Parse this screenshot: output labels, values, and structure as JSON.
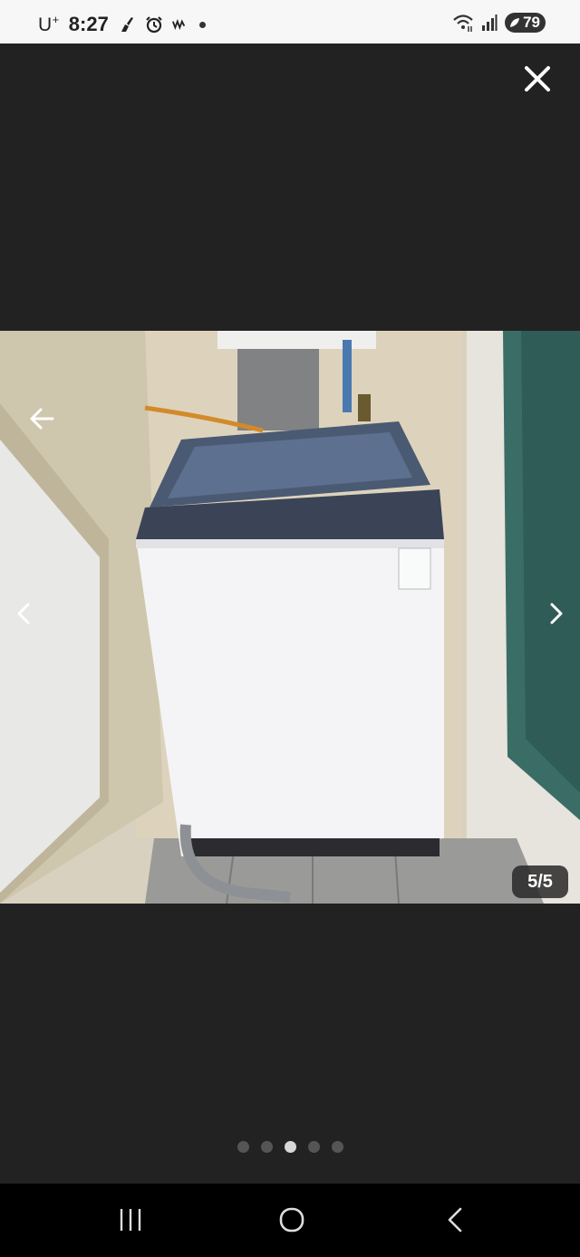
{
  "status_bar": {
    "carrier": "U",
    "carrier_sup": "+",
    "time": "8:27",
    "battery": "79",
    "icons": [
      "cleaning-app-icon",
      "alarm-icon",
      "wavve-icon",
      "notification-dot-icon",
      "wifi-icon",
      "signal-icon",
      "battery-icon"
    ]
  },
  "viewer": {
    "counter": "5/5",
    "pagination": {
      "total": 5,
      "active_index": 2
    },
    "icons": [
      "close-icon",
      "back-arrow-icon",
      "chevron-left-icon",
      "chevron-right-icon"
    ]
  },
  "colors": {
    "background": "#222222",
    "status_bar": "#f7f7f7",
    "nav_bar": "#000000",
    "dot_active": "#d8d8d8",
    "dot_inactive": "#555555"
  },
  "nav_bar": {
    "icons": [
      "recent-apps-icon",
      "home-icon",
      "back-icon"
    ]
  }
}
